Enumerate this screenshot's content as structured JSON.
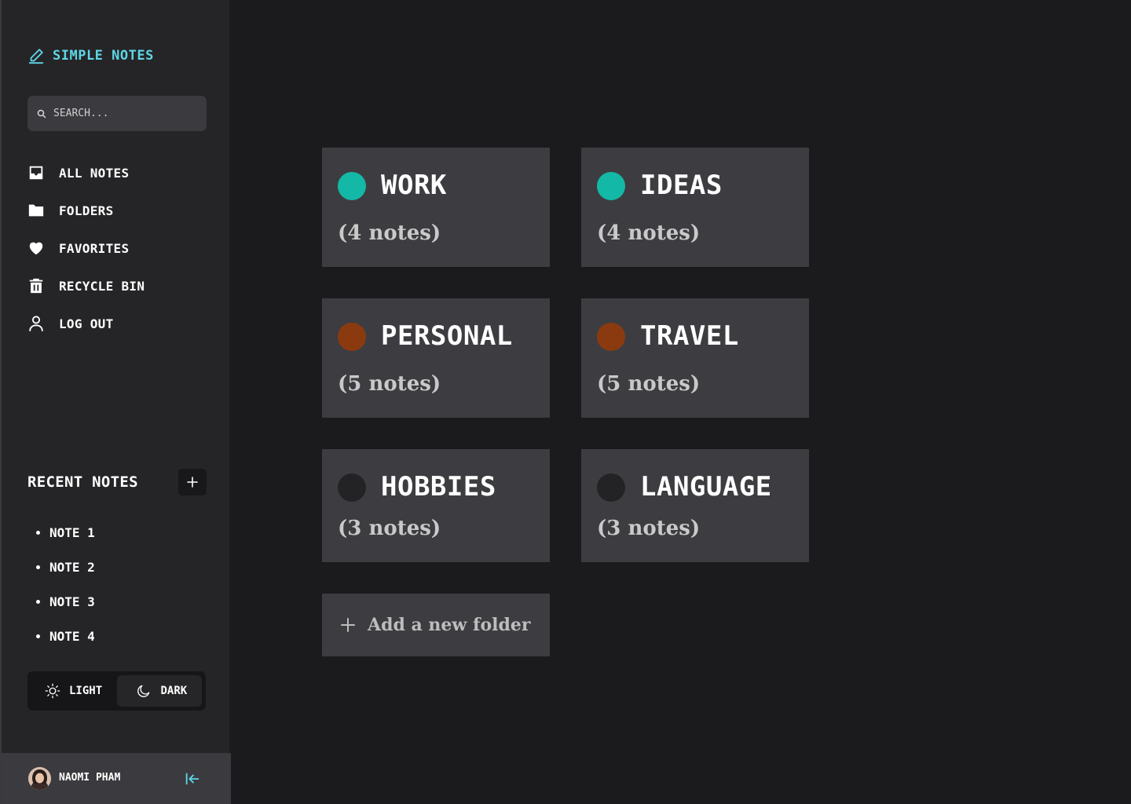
{
  "app": {
    "title": "SIMPLE NOTES"
  },
  "search": {
    "placeholder": "SEARCH..."
  },
  "nav": [
    {
      "label": "ALL NOTES",
      "icon": "inbox-icon"
    },
    {
      "label": "FOLDERS",
      "icon": "folder-icon"
    },
    {
      "label": "FAVORITES",
      "icon": "heart-icon"
    },
    {
      "label": "RECYCLE BIN",
      "icon": "trash-icon"
    },
    {
      "label": "LOG OUT",
      "icon": "user-icon"
    }
  ],
  "recent": {
    "title": "RECENT NOTES",
    "items": [
      "NOTE 1",
      "NOTE 2",
      "NOTE 3",
      "NOTE 4"
    ]
  },
  "theme": {
    "light_label": "LIGHT",
    "dark_label": "DARK",
    "selected": "DARK"
  },
  "user": {
    "name": "NAOMI PHAM"
  },
  "folders": [
    {
      "name": "WORK",
      "count": "(4 notes)",
      "color": "#14b8a6"
    },
    {
      "name": "IDEAS",
      "count": "(4 notes)",
      "color": "#14b8a6"
    },
    {
      "name": "PERSONAL",
      "count": "(5 notes)",
      "color": "#8b3a0f"
    },
    {
      "name": "TRAVEL",
      "count": "(5 notes)",
      "color": "#8b3a0f"
    },
    {
      "name": "HOBBIES",
      "count": "(3 notes)",
      "color": "#232325"
    },
    {
      "name": "LANGUAGE",
      "count": "(3 notes)",
      "color": "#232325"
    }
  ],
  "add_folder": {
    "label": "Add a new folder"
  },
  "colors": {
    "accent": "#5ed6e6",
    "card_bg": "#3d3d41",
    "sidebar_bg": "#252527",
    "page_bg": "#1b1b1d"
  }
}
